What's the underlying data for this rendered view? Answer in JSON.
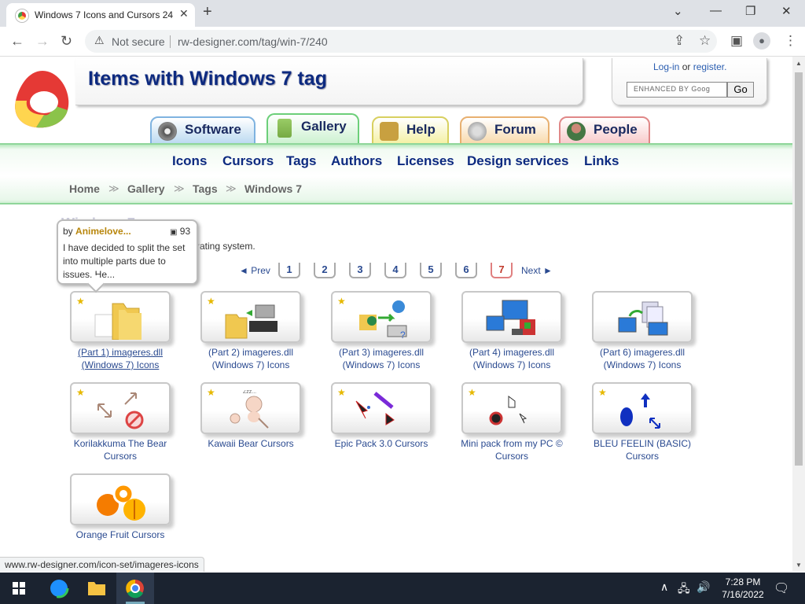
{
  "browser": {
    "tab_title": "Windows 7 Icons and Cursors 24",
    "new_tab": "+",
    "not_secure": "Not secure",
    "url": "rw-designer.com/tag/win-7/240",
    "status_url": "www.rw-designer.com/icon-set/imageres-icons"
  },
  "header": {
    "title": "Items with Windows 7 tag",
    "login": "Log-in",
    "or": "or",
    "register": "register.",
    "search_placeholder": "ENHANCED BY Goog",
    "go": "Go"
  },
  "main_tabs": [
    {
      "label": "Software",
      "icon": "cd-icon"
    },
    {
      "label": "Gallery",
      "icon": "gallery-icon"
    },
    {
      "label": "Help",
      "icon": "help-icon"
    },
    {
      "label": "Forum",
      "icon": "forum-icon"
    },
    {
      "label": "People",
      "icon": "people-icon"
    }
  ],
  "nav_links": [
    "Icons",
    "Cursors",
    "Tags",
    "Authors",
    "Licenses",
    "Design services",
    "Links"
  ],
  "breadcrumb": [
    "Home",
    "Gallery",
    "Tags",
    "Windows 7"
  ],
  "section": {
    "heading_partial": "Windows 7",
    "description_partial": "rating system."
  },
  "tooltip": {
    "by": "by",
    "author": "Animelove...",
    "count": "93",
    "text": "I have decided to split the set into multiple parts due to issues. He..."
  },
  "pager": {
    "prev": "◄ Prev",
    "pages": [
      "1",
      "2",
      "3",
      "4",
      "5",
      "6",
      "7"
    ],
    "current": "7",
    "next": "Next ►"
  },
  "items": [
    {
      "label": "(Part 1) imageres.dll (Windows 7) Icons",
      "thumb": "folder-icon",
      "hover": true
    },
    {
      "label": "(Part 2) imageres.dll (Windows 7) Icons",
      "thumb": "folder-chip-icon"
    },
    {
      "label": "(Part 3) imageres.dll (Windows 7) Icons",
      "thumb": "network-icon"
    },
    {
      "label": "(Part 4) imageres.dll (Windows 7) Icons",
      "thumb": "computer-icon"
    },
    {
      "label": "(Part 6) imageres.dll (Windows 7) Icons",
      "thumb": "sync-icon"
    },
    {
      "label": "Korilakkuma The Bear Cursors",
      "thumb": "resize-icon"
    },
    {
      "label": "Kawaii Bear Cursors",
      "thumb": "bear-icon"
    },
    {
      "label": "Epic Pack 3.0 Cursors",
      "thumb": "arrow-icon"
    },
    {
      "label": "Mini pack from my PC © Cursors",
      "thumb": "hand-icon"
    },
    {
      "label": "BLEU FEELIN (BASIC) Cursors",
      "thumb": "blue-cursor-icon"
    },
    {
      "label": "Orange Fruit Cursors",
      "thumb": "orange-icon"
    }
  ],
  "taskbar": {
    "time": "7:28 PM",
    "date": "7/16/2022"
  }
}
